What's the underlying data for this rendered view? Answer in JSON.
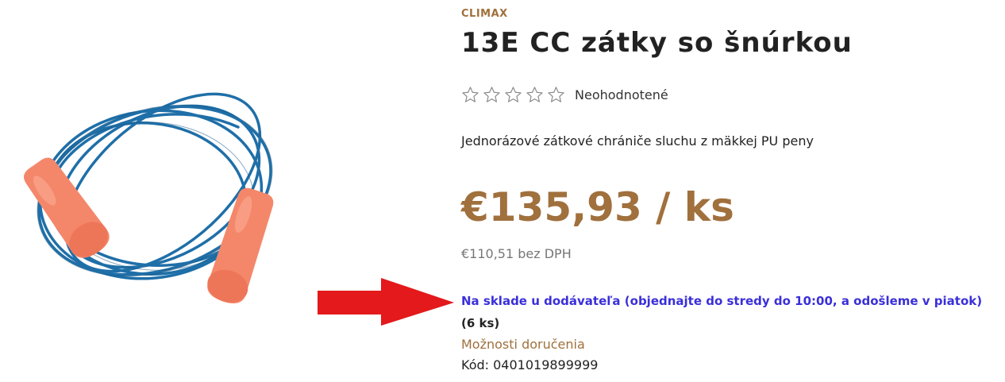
{
  "product": {
    "brand": "CLIMAX",
    "title": "13E CC zátky so šnúrkou",
    "rating": {
      "stars_filled": 0,
      "stars_total": 5,
      "label": "Neohodnotené"
    },
    "short_description": "Jednorázové zátkové chrániče sluchu z mäkkej PU peny",
    "price": "€135,93 / ks",
    "price_net": "€110,51 bez DPH",
    "stock_status": "Na sklade u dodávateľa (objednajte do stredy do 10:00, a odošleme v piatok)",
    "stock_quantity": "(6 ks)",
    "delivery_options_label": "Možnosti doručenia",
    "code": "Kód: 0401019899999"
  },
  "colors": {
    "accent_brown": "#a0703d",
    "stock_blue": "#3a2fd9",
    "arrow_red": "#e3191b",
    "earplug_orange": "#f4876a",
    "cord_blue": "#1f6fa8"
  }
}
